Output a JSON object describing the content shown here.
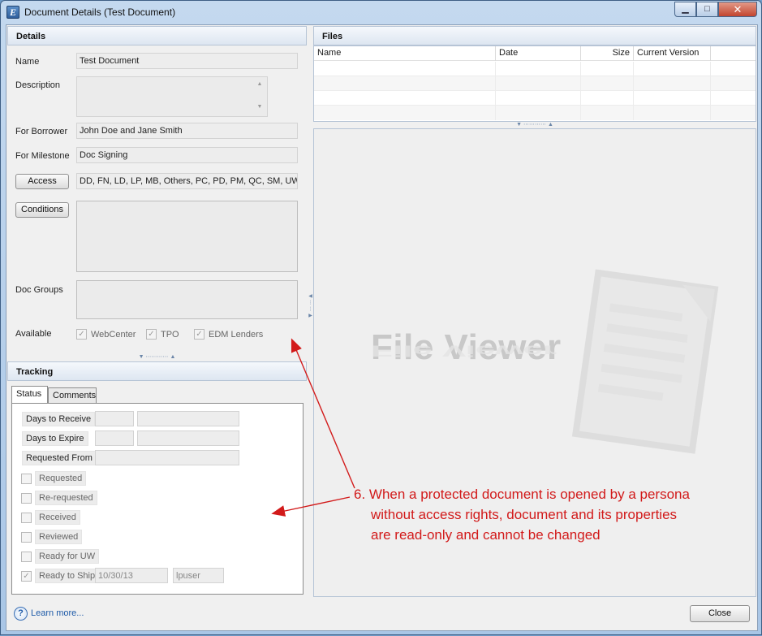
{
  "window": {
    "app_icon_letter": "E",
    "title": "Document Details (Test Document)",
    "minimize_symbol": "▁",
    "maximize_symbol": "□",
    "close_symbol": "✕"
  },
  "details": {
    "header": "Details",
    "name_label": "Name",
    "name_value": "Test Document",
    "description_label": "Description",
    "description_value": "",
    "borrower_label": "For Borrower",
    "borrower_value": "John Doe and Jane Smith",
    "milestone_label": "For Milestone",
    "milestone_value": "Doc Signing",
    "access_button": "Access",
    "access_value": "DD, FN, LD, LP, MB, Others, PC, PD, PM, QC, SM, UW",
    "conditions_button": "Conditions",
    "doc_groups_label": "Doc Groups",
    "available_label": "Available",
    "available_options": [
      {
        "label": "WebCenter",
        "checked": true
      },
      {
        "label": "TPO",
        "checked": true
      },
      {
        "label": "EDM Lenders",
        "checked": true
      }
    ]
  },
  "tracking": {
    "header": "Tracking",
    "tabs": [
      "Status",
      "Comments"
    ],
    "active_tab": "Status",
    "days_to_receive_label": "Days to Receive",
    "days_to_expire_label": "Days to Expire",
    "requested_from_label": "Requested From",
    "statuses": [
      {
        "label": "Requested",
        "checked": false
      },
      {
        "label": "Re-requested",
        "checked": false
      },
      {
        "label": "Received",
        "checked": false
      },
      {
        "label": "Reviewed",
        "checked": false
      },
      {
        "label": "Ready for UW",
        "checked": false
      },
      {
        "label": "Ready to Ship",
        "checked": true,
        "date": "10/30/13",
        "user": "lpuser"
      }
    ]
  },
  "files": {
    "header": "Files",
    "columns": [
      "Name",
      "Date",
      "Size",
      "Current Version"
    ],
    "rows": [],
    "viewer_watermark": "File Viewer"
  },
  "footer": {
    "help_symbol": "?",
    "learn_more": "Learn more...",
    "close_button": "Close"
  },
  "annotation": {
    "line1": "6. When a protected document is opened by a persona",
    "line2": "without access rights, document and its properties",
    "line3": "are read-only and cannot be changed",
    "color": "#d21a1a"
  }
}
